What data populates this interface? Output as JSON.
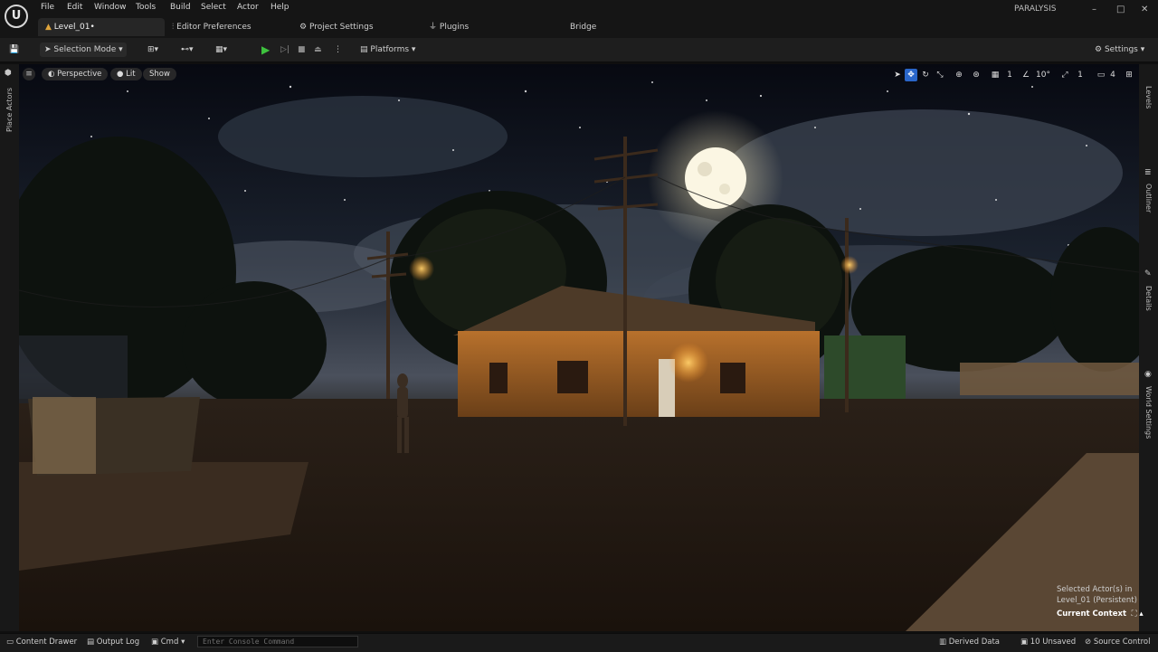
{
  "app": {
    "logo": "U",
    "project_name": "PARALYSIS"
  },
  "menu": [
    "File",
    "Edit",
    "Window",
    "Tools",
    "Build",
    "Select",
    "Actor",
    "Help"
  ],
  "window_controls": {
    "minimize": "–",
    "maximize": "□",
    "close": "✕"
  },
  "tabs": {
    "level": {
      "label": "Level_01•",
      "icon": "warning-icon"
    },
    "editor_prefs": "Editor Preferences",
    "project_settings": "Project Settings",
    "plugins": "Plugins",
    "bridge": "Bridge"
  },
  "toolbar": {
    "selection_mode": "Selection Mode",
    "platforms": "Platforms",
    "settings": "Settings"
  },
  "viewport": {
    "perspective": "Perspective",
    "lit": "Lit",
    "show": "Show",
    "grid_size": "1",
    "angle_snap": "10°",
    "scale_snap": "1",
    "camera_speed": "4"
  },
  "left_panel": {
    "place_actors": "Place Actors"
  },
  "right_panel": {
    "levels": "Levels",
    "outliner": "Outliner",
    "details": "Details",
    "world_settings": "World Settings"
  },
  "overlay": {
    "selected_line1": "Selected Actor(s) in",
    "selected_line2": "Level_01 (Persistent)",
    "current_context": "Current Context"
  },
  "bottom_bar": {
    "content_drawer": "Content Drawer",
    "output_log": "Output Log",
    "cmd": "Cmd",
    "console_placeholder": "Enter Console Command",
    "derived_data": "Derived Data",
    "unsaved": "10 Unsaved",
    "source_control": "Source Control"
  },
  "colors": {
    "accent_blue": "#2a66c9",
    "play_green": "#3ec23e",
    "warning": "#e0a53c"
  }
}
